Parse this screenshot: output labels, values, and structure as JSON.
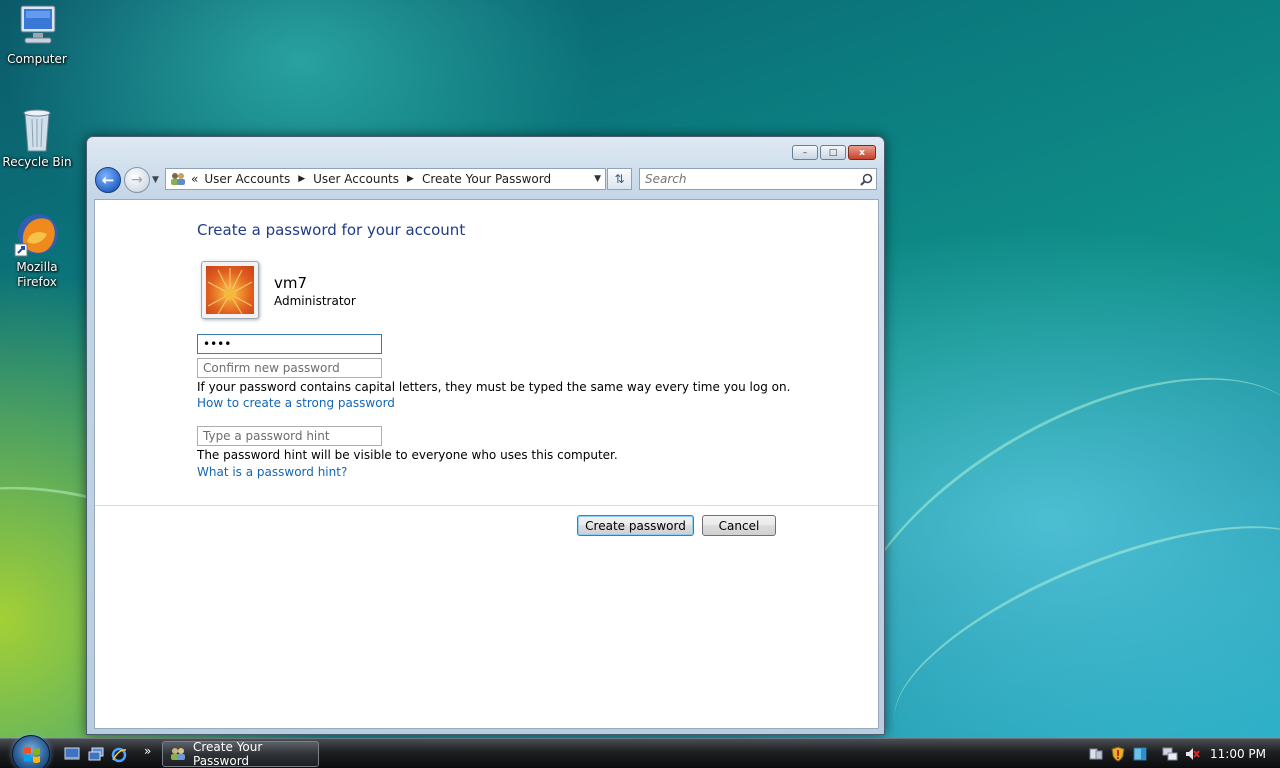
{
  "desktop": {
    "icons": [
      {
        "label": "Computer"
      },
      {
        "label": "Recycle Bin"
      },
      {
        "label": "Mozilla Firefox"
      }
    ]
  },
  "window": {
    "caption": {
      "minimize": "–",
      "maximize": "□",
      "close": "x"
    },
    "address": {
      "crumbs": [
        "User Accounts",
        "User Accounts",
        "Create Your Password"
      ],
      "prefix": "«"
    },
    "search": {
      "placeholder": "Search"
    },
    "content": {
      "title": "Create a password for your account",
      "user_name": "vm7",
      "user_role": "Administrator",
      "new_password_value": "••••",
      "confirm_placeholder": "Confirm new password",
      "caps_note": "If your password contains capital letters, they must be typed the same way every time you log on.",
      "strong_link": "How to create a strong password",
      "hint_placeholder": "Type a password hint",
      "hint_note": "The password hint will be visible to everyone who uses this computer.",
      "hint_link": "What is a password hint?",
      "create_button": "Create password",
      "cancel_button": "Cancel"
    }
  },
  "taskbar": {
    "overflow": "»",
    "task_label": "Create Your Password",
    "clock": "11:00 PM"
  },
  "colors": {
    "title_blue": "#1e3c87",
    "link_blue": "#1467b5",
    "taskbar": "#1d1f22"
  }
}
